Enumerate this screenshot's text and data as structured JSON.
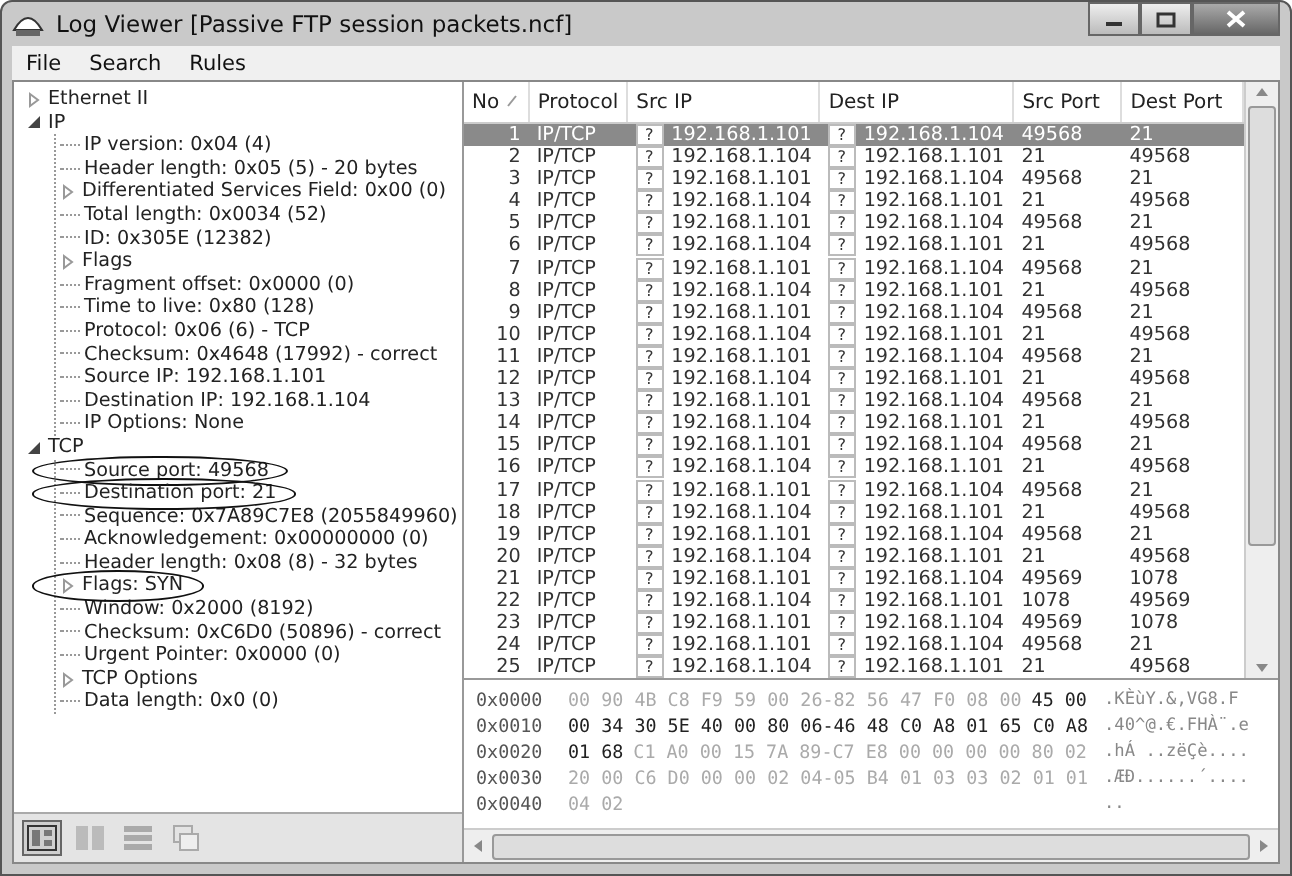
{
  "window": {
    "title": "Log Viewer [Passive FTP session packets.ncf]"
  },
  "menu": [
    "File",
    "Search",
    "Rules"
  ],
  "tree": [
    {
      "label": "Ethernet II",
      "expandable": true,
      "expanded": false
    },
    {
      "label": "IP",
      "expandable": true,
      "expanded": true,
      "children": [
        {
          "label": "IP version: 0x04 (4)"
        },
        {
          "label": "Header length: 0x05 (5) - 20 bytes"
        },
        {
          "label": "Differentiated Services Field: 0x00 (0)",
          "expandable": true,
          "expanded": false
        },
        {
          "label": "Total length: 0x0034 (52)"
        },
        {
          "label": "ID: 0x305E (12382)"
        },
        {
          "label": "Flags",
          "expandable": true,
          "expanded": false
        },
        {
          "label": "Fragment offset: 0x0000 (0)"
        },
        {
          "label": "Time to live: 0x80 (128)"
        },
        {
          "label": "Protocol: 0x06 (6) - TCP"
        },
        {
          "label": "Checksum: 0x4648 (17992) - correct"
        },
        {
          "label": "Source IP: 192.168.1.101"
        },
        {
          "label": "Destination IP: 192.168.1.104"
        },
        {
          "label": "IP Options: None"
        }
      ]
    },
    {
      "label": "TCP",
      "expandable": true,
      "expanded": true,
      "children": [
        {
          "label": "Source port: 49568",
          "circled": true
        },
        {
          "label": "Destination port: 21",
          "circled": true
        },
        {
          "label": "Sequence: 0x7A89C7E8 (2055849960)"
        },
        {
          "label": "Acknowledgement: 0x00000000 (0)"
        },
        {
          "label": "Header length: 0x08 (8) - 32 bytes"
        },
        {
          "label": "Flags: SYN",
          "expandable": true,
          "expanded": false,
          "circled": true
        },
        {
          "label": "Window: 0x2000 (8192)"
        },
        {
          "label": "Checksum: 0xC6D0 (50896) - correct"
        },
        {
          "label": "Urgent Pointer: 0x0000 (0)"
        },
        {
          "label": "TCP Options",
          "expandable": true,
          "expanded": false
        },
        {
          "label": "Data length: 0x0 (0)"
        }
      ]
    }
  ],
  "layout_buttons": [
    {
      "selected": true
    },
    {
      "selected": false
    },
    {
      "selected": false
    },
    {
      "selected": false
    }
  ],
  "table": {
    "columns": [
      "No",
      "Protocol",
      "Src IP",
      "Dest IP",
      "Src Port",
      "Dest Port"
    ],
    "rows": [
      {
        "no": "1",
        "protocol": "IP/TCP",
        "src_flag": "?",
        "src_ip": "192.168.1.101",
        "dest_flag": "?",
        "dest_ip": "192.168.1.104",
        "src_port": "49568",
        "dest_port": "21",
        "selected": true
      },
      {
        "no": "2",
        "protocol": "IP/TCP",
        "src_flag": "?",
        "src_ip": "192.168.1.104",
        "dest_flag": "?",
        "dest_ip": "192.168.1.101",
        "src_port": "21",
        "dest_port": "49568",
        "selected": false
      },
      {
        "no": "3",
        "protocol": "IP/TCP",
        "src_flag": "?",
        "src_ip": "192.168.1.101",
        "dest_flag": "?",
        "dest_ip": "192.168.1.104",
        "src_port": "49568",
        "dest_port": "21",
        "selected": false
      },
      {
        "no": "4",
        "protocol": "IP/TCP",
        "src_flag": "?",
        "src_ip": "192.168.1.104",
        "dest_flag": "?",
        "dest_ip": "192.168.1.101",
        "src_port": "21",
        "dest_port": "49568",
        "selected": false
      },
      {
        "no": "5",
        "protocol": "IP/TCP",
        "src_flag": "?",
        "src_ip": "192.168.1.101",
        "dest_flag": "?",
        "dest_ip": "192.168.1.104",
        "src_port": "49568",
        "dest_port": "21",
        "selected": false
      },
      {
        "no": "6",
        "protocol": "IP/TCP",
        "src_flag": "?",
        "src_ip": "192.168.1.104",
        "dest_flag": "?",
        "dest_ip": "192.168.1.101",
        "src_port": "21",
        "dest_port": "49568",
        "selected": false
      },
      {
        "no": "7",
        "protocol": "IP/TCP",
        "src_flag": "?",
        "src_ip": "192.168.1.101",
        "dest_flag": "?",
        "dest_ip": "192.168.1.104",
        "src_port": "49568",
        "dest_port": "21",
        "selected": false
      },
      {
        "no": "8",
        "protocol": "IP/TCP",
        "src_flag": "?",
        "src_ip": "192.168.1.104",
        "dest_flag": "?",
        "dest_ip": "192.168.1.101",
        "src_port": "21",
        "dest_port": "49568",
        "selected": false
      },
      {
        "no": "9",
        "protocol": "IP/TCP",
        "src_flag": "?",
        "src_ip": "192.168.1.101",
        "dest_flag": "?",
        "dest_ip": "192.168.1.104",
        "src_port": "49568",
        "dest_port": "21",
        "selected": false
      },
      {
        "no": "10",
        "protocol": "IP/TCP",
        "src_flag": "?",
        "src_ip": "192.168.1.104",
        "dest_flag": "?",
        "dest_ip": "192.168.1.101",
        "src_port": "21",
        "dest_port": "49568",
        "selected": false
      },
      {
        "no": "11",
        "protocol": "IP/TCP",
        "src_flag": "?",
        "src_ip": "192.168.1.101",
        "dest_flag": "?",
        "dest_ip": "192.168.1.104",
        "src_port": "49568",
        "dest_port": "21",
        "selected": false
      },
      {
        "no": "12",
        "protocol": "IP/TCP",
        "src_flag": "?",
        "src_ip": "192.168.1.104",
        "dest_flag": "?",
        "dest_ip": "192.168.1.101",
        "src_port": "21",
        "dest_port": "49568",
        "selected": false
      },
      {
        "no": "13",
        "protocol": "IP/TCP",
        "src_flag": "?",
        "src_ip": "192.168.1.101",
        "dest_flag": "?",
        "dest_ip": "192.168.1.104",
        "src_port": "49568",
        "dest_port": "21",
        "selected": false
      },
      {
        "no": "14",
        "protocol": "IP/TCP",
        "src_flag": "?",
        "src_ip": "192.168.1.104",
        "dest_flag": "?",
        "dest_ip": "192.168.1.101",
        "src_port": "21",
        "dest_port": "49568",
        "selected": false
      },
      {
        "no": "15",
        "protocol": "IP/TCP",
        "src_flag": "?",
        "src_ip": "192.168.1.101",
        "dest_flag": "?",
        "dest_ip": "192.168.1.104",
        "src_port": "49568",
        "dest_port": "21",
        "selected": false
      },
      {
        "no": "16",
        "protocol": "IP/TCP",
        "src_flag": "?",
        "src_ip": "192.168.1.104",
        "dest_flag": "?",
        "dest_ip": "192.168.1.101",
        "src_port": "21",
        "dest_port": "49568",
        "selected": false
      },
      {
        "no": "17",
        "protocol": "IP/TCP",
        "src_flag": "?",
        "src_ip": "192.168.1.101",
        "dest_flag": "?",
        "dest_ip": "192.168.1.104",
        "src_port": "49568",
        "dest_port": "21",
        "selected": false
      },
      {
        "no": "18",
        "protocol": "IP/TCP",
        "src_flag": "?",
        "src_ip": "192.168.1.104",
        "dest_flag": "?",
        "dest_ip": "192.168.1.101",
        "src_port": "21",
        "dest_port": "49568",
        "selected": false
      },
      {
        "no": "19",
        "protocol": "IP/TCP",
        "src_flag": "?",
        "src_ip": "192.168.1.101",
        "dest_flag": "?",
        "dest_ip": "192.168.1.104",
        "src_port": "49568",
        "dest_port": "21",
        "selected": false
      },
      {
        "no": "20",
        "protocol": "IP/TCP",
        "src_flag": "?",
        "src_ip": "192.168.1.104",
        "dest_flag": "?",
        "dest_ip": "192.168.1.101",
        "src_port": "21",
        "dest_port": "49568",
        "selected": false
      },
      {
        "no": "21",
        "protocol": "IP/TCP",
        "src_flag": "?",
        "src_ip": "192.168.1.101",
        "dest_flag": "?",
        "dest_ip": "192.168.1.104",
        "src_port": "49569",
        "dest_port": "1078",
        "selected": false
      },
      {
        "no": "22",
        "protocol": "IP/TCP",
        "src_flag": "?",
        "src_ip": "192.168.1.104",
        "dest_flag": "?",
        "dest_ip": "192.168.1.101",
        "src_port": "1078",
        "dest_port": "49569",
        "selected": false
      },
      {
        "no": "23",
        "protocol": "IP/TCP",
        "src_flag": "?",
        "src_ip": "192.168.1.101",
        "dest_flag": "?",
        "dest_ip": "192.168.1.104",
        "src_port": "49569",
        "dest_port": "1078",
        "selected": false
      },
      {
        "no": "24",
        "protocol": "IP/TCP",
        "src_flag": "?",
        "src_ip": "192.168.1.101",
        "dest_flag": "?",
        "dest_ip": "192.168.1.104",
        "src_port": "49568",
        "dest_port": "21",
        "selected": false
      },
      {
        "no": "25",
        "protocol": "IP/TCP",
        "src_flag": "?",
        "src_ip": "192.168.1.104",
        "dest_flag": "?",
        "dest_ip": "192.168.1.101",
        "src_port": "21",
        "dest_port": "49568",
        "selected": false
      }
    ]
  },
  "hex_dump": [
    {
      "offset": "0x0000",
      "bytes": [
        {
          "text": "00 90 4B C8 F9 59 00 26-82 56 47 F0 08 00",
          "highlighted": false
        },
        {
          "text": "45 00",
          "highlighted": true
        }
      ],
      "ascii": ".KÈùY.&,VG8.F"
    },
    {
      "offset": "0x0010",
      "bytes": [
        {
          "text": "00 34 30 5E 40 00 80 06-46 48 C0 A8 01 65 C0 A8",
          "highlighted": true
        }
      ],
      "ascii": ".40^@.€.FHÀ¨.e"
    },
    {
      "offset": "0x0020",
      "bytes": [
        {
          "text": "01 68",
          "highlighted": true
        },
        {
          "text": "C1 A0 00 15 7A 89-C7 E8 00 00 00 00 80 02",
          "highlighted": false
        }
      ],
      "ascii": ".hÁ ..zëÇè...."
    },
    {
      "offset": "0x0030",
      "bytes": [
        {
          "text": "20 00 C6 D0 00 00 02 04-05 B4 01 03 03 02 01 01",
          "highlighted": false
        }
      ],
      "ascii": " .ÆÐ......´...."
    },
    {
      "offset": "0x0040",
      "bytes": [
        {
          "text": "04 02",
          "highlighted": false
        }
      ],
      "ascii": ".."
    }
  ]
}
